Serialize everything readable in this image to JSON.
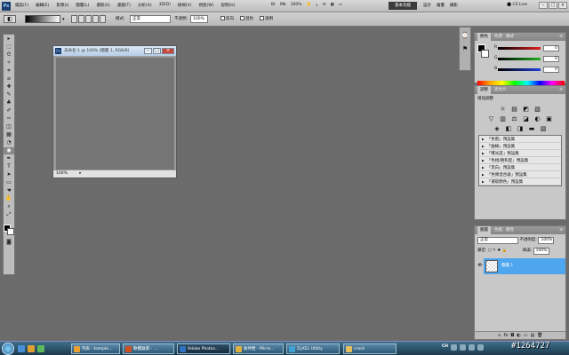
{
  "menubar": {
    "logo": "Ps",
    "items": [
      "檔案(F)",
      "編輯(E)",
      "影像(I)",
      "圖層(L)",
      "選取(S)",
      "濾鏡(T)",
      "分析(A)",
      "3D(D)",
      "檢視(V)",
      "視窗(W)",
      "說明(H)"
    ],
    "zoom": "100%",
    "workspace": "基本功能",
    "workspace_links": [
      "設計",
      "繪畫",
      "攝影"
    ],
    "cslive": "CS Live",
    "win_buttons": [
      "–",
      "□",
      "×"
    ]
  },
  "options": {
    "mode_label": "模式:",
    "mode_value": "正常",
    "opacity_label": "不透明:",
    "opacity_value": "100%",
    "checks": [
      "反向",
      "混色",
      "透明"
    ]
  },
  "tools": [
    "▸",
    "⬚",
    "ᘓ",
    "✧",
    "⌗",
    "⌀",
    "✚",
    "✎",
    "♣",
    "✐",
    "✑",
    "◫",
    "▦",
    "◔",
    "◉",
    "✒",
    "T",
    "➤",
    "▭",
    "☚",
    "✋",
    "⌕",
    "⤢"
  ],
  "document": {
    "title": "未命名-1 @ 100% (圖層 1, RGB/8)",
    "zoom": "100%",
    "buttons": [
      "–",
      "□",
      "×"
    ]
  },
  "panels": {
    "color_tabs": [
      "顏色",
      "色票",
      "樣式"
    ],
    "color_sliders": [
      {
        "label": "R",
        "value": "0",
        "color": "#e02020"
      },
      {
        "label": "G",
        "value": "0",
        "color": "#20b020"
      },
      {
        "label": "B",
        "value": "0",
        "color": "#2040e0"
      }
    ],
    "adjust_tabs": [
      "調整",
      "遮色片"
    ],
    "adjust_title": "增加調整",
    "adjust_icons_row1": [
      "☼",
      "▤",
      "◩",
      "▧"
    ],
    "adjust_icons_row2": [
      "▽",
      "▥",
      "⚖",
      "◪",
      "◐",
      "▣"
    ],
    "adjust_icons_row3": [
      "◈",
      "◧",
      "◨",
      "▬",
      "▧"
    ],
    "presets": [
      "「色階」預設集",
      "「曲線」預設集",
      "「曝光度」預設集",
      "「色相/飽和度」預設集",
      "「黑白」預設集",
      "「色頻混合器」預設集",
      "「選取顏色」預設集"
    ],
    "layer_tabs": [
      "圖層",
      "色版",
      "路徑"
    ],
    "blend": "正常",
    "opacity_label": "不透明度:",
    "opacity_value": "100%",
    "lock_label": "鎖定:",
    "fill_label": "填滿:",
    "fill_value": "100%",
    "layer_name": "圖層 1",
    "layer_footer_icons": [
      "∞",
      "fx",
      "◘",
      "◐",
      "▭",
      "▤",
      "🗑"
    ]
  },
  "taskbar": {
    "tasks": [
      {
        "label": "列表 - kample...",
        "color": "#e8a030"
      },
      {
        "label": "軟體論壇 - ...",
        "color": "#d05020"
      },
      {
        "label": "Adobe Photos...",
        "color": "#3070c0"
      },
      {
        "label": "收件匣 - Micro...",
        "color": "#e0b040"
      },
      {
        "label": "ZyXEL Utility",
        "color": "#40a0d0"
      },
      {
        "label": "crack",
        "color": "#e8c060"
      }
    ],
    "tray_lang": "CH",
    "watermark": "#1264727"
  }
}
